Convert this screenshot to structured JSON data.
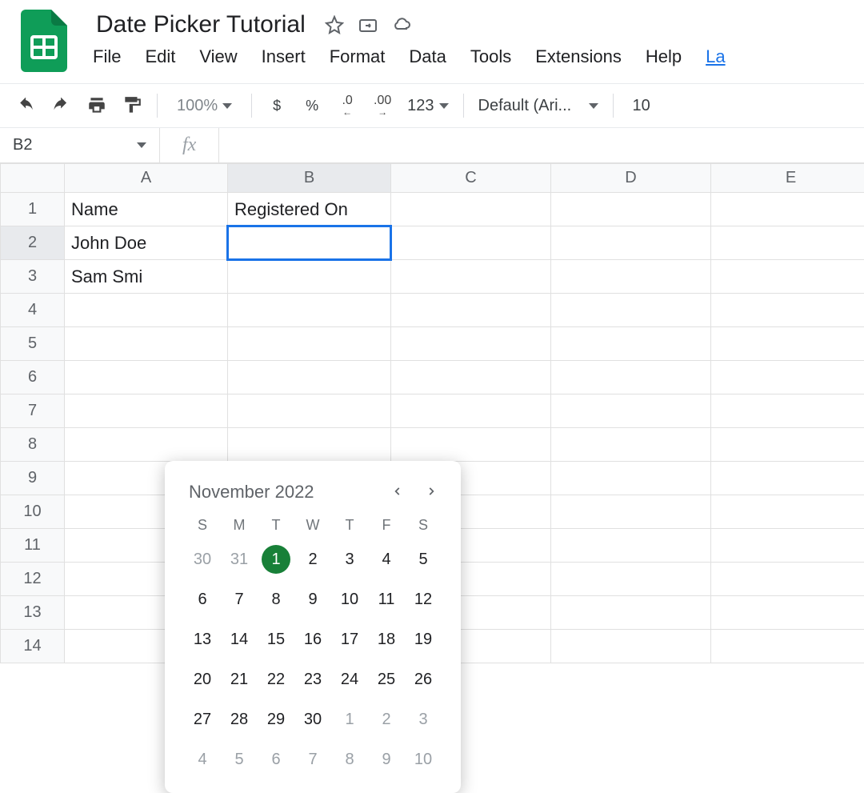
{
  "doc": {
    "title": "Date Picker Tutorial"
  },
  "menus": [
    "File",
    "Edit",
    "View",
    "Insert",
    "Format",
    "Data",
    "Tools",
    "Extensions",
    "Help",
    "La"
  ],
  "toolbar": {
    "zoom": "100%",
    "currency": "$",
    "percent": "%",
    "dec_dec": ".0",
    "inc_dec": ".00",
    "format123": "123",
    "font": "Default (Ari...",
    "fontsize": "10"
  },
  "namebox": "B2",
  "fx": "fx",
  "columns": [
    "A",
    "B",
    "C",
    "D",
    "E"
  ],
  "rows": [
    "1",
    "2",
    "3",
    "4",
    "5",
    "6",
    "7",
    "8",
    "9",
    "10",
    "11",
    "12",
    "13",
    "14"
  ],
  "cells": {
    "A1": "Name",
    "B1": "Registered On",
    "A2": "John Doe",
    "A3": "Sam Smi"
  },
  "datepicker": {
    "title": "November 2022",
    "dow": [
      "S",
      "M",
      "T",
      "W",
      "T",
      "F",
      "S"
    ],
    "weeks": [
      [
        {
          "d": "30",
          "o": true
        },
        {
          "d": "31",
          "o": true
        },
        {
          "d": "1",
          "sel": true
        },
        {
          "d": "2"
        },
        {
          "d": "3"
        },
        {
          "d": "4"
        },
        {
          "d": "5"
        }
      ],
      [
        {
          "d": "6"
        },
        {
          "d": "7"
        },
        {
          "d": "8"
        },
        {
          "d": "9"
        },
        {
          "d": "10"
        },
        {
          "d": "11"
        },
        {
          "d": "12"
        }
      ],
      [
        {
          "d": "13"
        },
        {
          "d": "14"
        },
        {
          "d": "15"
        },
        {
          "d": "16"
        },
        {
          "d": "17"
        },
        {
          "d": "18"
        },
        {
          "d": "19"
        }
      ],
      [
        {
          "d": "20"
        },
        {
          "d": "21"
        },
        {
          "d": "22"
        },
        {
          "d": "23"
        },
        {
          "d": "24"
        },
        {
          "d": "25"
        },
        {
          "d": "26"
        }
      ],
      [
        {
          "d": "27"
        },
        {
          "d": "28"
        },
        {
          "d": "29"
        },
        {
          "d": "30"
        },
        {
          "d": "1",
          "o": true
        },
        {
          "d": "2",
          "o": true
        },
        {
          "d": "3",
          "o": true
        }
      ],
      [
        {
          "d": "4",
          "o": true
        },
        {
          "d": "5",
          "o": true
        },
        {
          "d": "6",
          "o": true
        },
        {
          "d": "7",
          "o": true
        },
        {
          "d": "8",
          "o": true
        },
        {
          "d": "9",
          "o": true
        },
        {
          "d": "10",
          "o": true
        }
      ]
    ]
  }
}
